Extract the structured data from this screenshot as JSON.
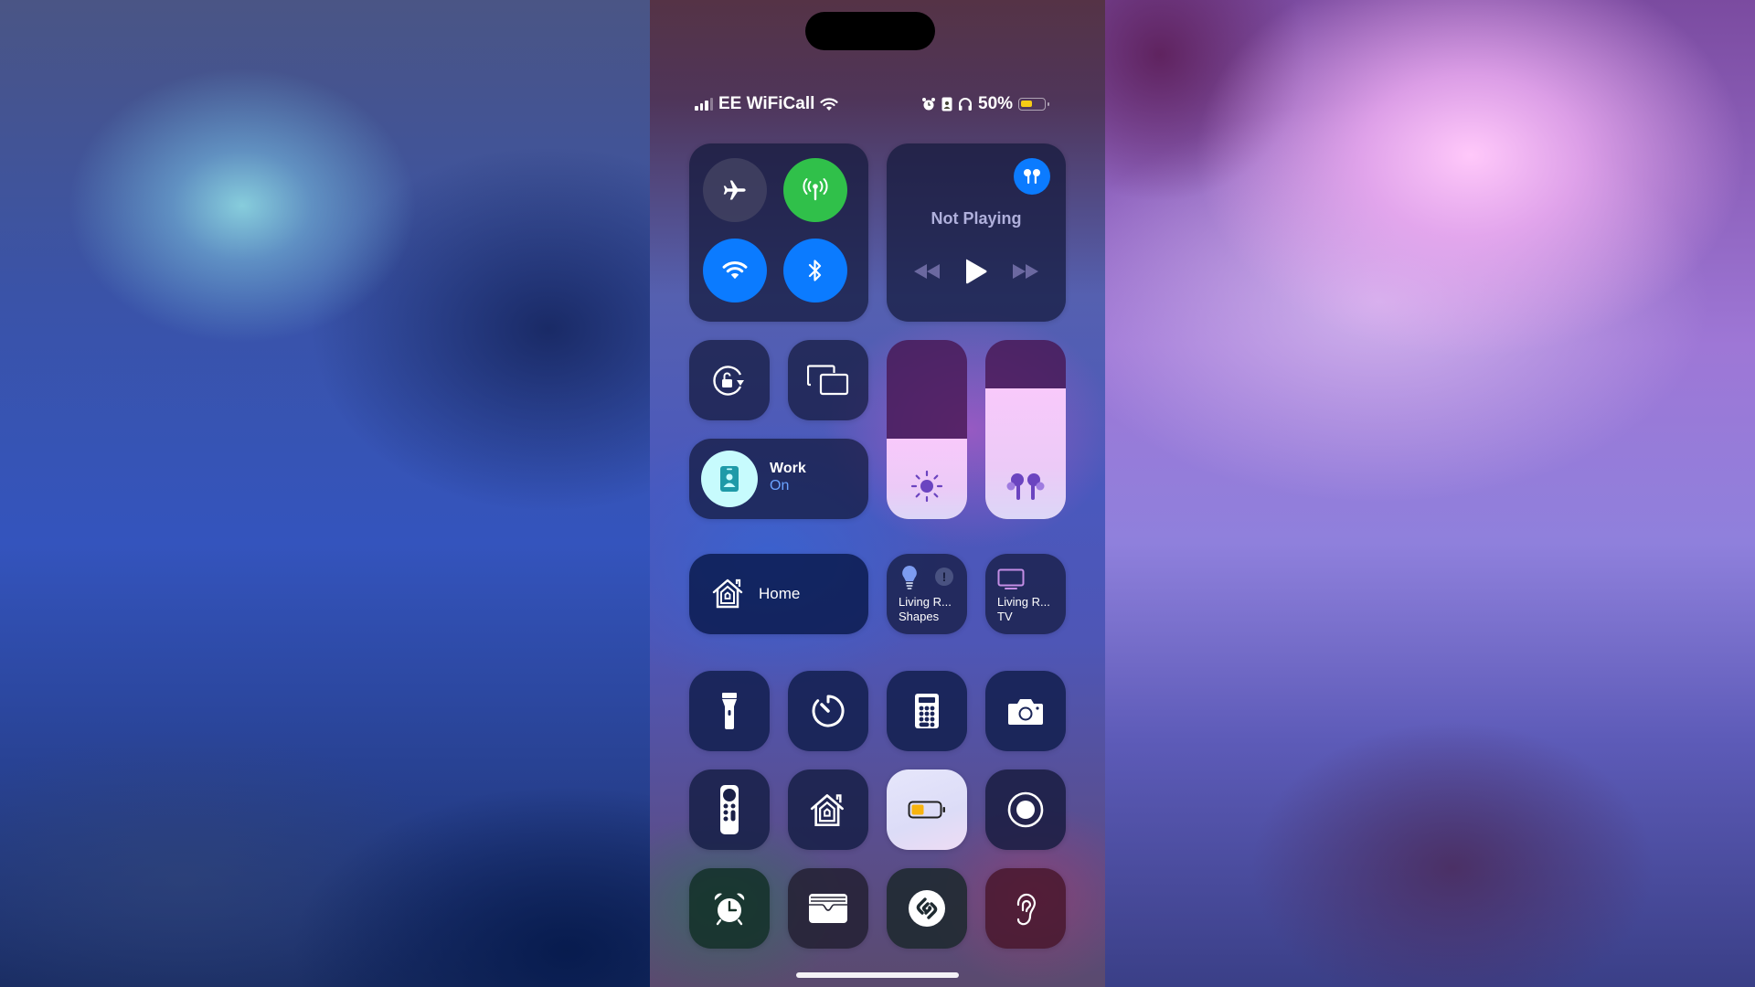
{
  "status_bar": {
    "carrier": "EE WiFiCall",
    "battery_percent_label": "50%",
    "battery_level": 0.5,
    "signal_bars": 3,
    "signal_bars_total": 4,
    "icons": [
      "cellular-signal-icon",
      "wifi-icon",
      "alarm-icon",
      "work-focus-icon",
      "headphones-icon",
      "battery-icon"
    ]
  },
  "connectivity": {
    "airplane_mode": {
      "label": "Airplane Mode",
      "on": false
    },
    "cellular_data": {
      "label": "Cellular Data",
      "on": true,
      "color": "#30c04a"
    },
    "wifi": {
      "label": "Wi-Fi",
      "on": true,
      "color": "#0b7bff"
    },
    "bluetooth": {
      "label": "Bluetooth",
      "on": true,
      "color": "#0b7bff"
    }
  },
  "media": {
    "title": "Not Playing",
    "output_device": "airpods-icon",
    "controls": [
      "rewind-icon",
      "play-icon",
      "fast-forward-icon"
    ]
  },
  "toggles": {
    "orientation_lock": "orientation-lock-icon",
    "screen_mirroring": "screen-mirroring-icon"
  },
  "focus": {
    "name": "Work",
    "state": "On"
  },
  "sliders": {
    "brightness": {
      "label": "Brightness",
      "level_percent": 45
    },
    "volume": {
      "label": "Volume",
      "level_percent": 73
    }
  },
  "home": {
    "label": "Home",
    "accessories": [
      {
        "line1": "Living R...",
        "line2": "Shapes",
        "icon": "lightbulb-icon",
        "alert": true
      },
      {
        "line1": "Living R...",
        "line2": "TV",
        "icon": "tv-icon",
        "alert": false
      }
    ]
  },
  "app_tiles": [
    {
      "name": "flashlight",
      "icon": "flashlight-icon"
    },
    {
      "name": "timer",
      "icon": "timer-icon"
    },
    {
      "name": "calculator",
      "icon": "calculator-icon"
    },
    {
      "name": "camera",
      "icon": "camera-icon"
    },
    {
      "name": "apple-tv-remote",
      "icon": "remote-icon"
    },
    {
      "name": "home-app",
      "icon": "home-icon"
    },
    {
      "name": "low-power-mode",
      "icon": "battery-icon",
      "on": true
    },
    {
      "name": "screen-recording",
      "icon": "screen-record-icon"
    },
    {
      "name": "alarm",
      "icon": "alarm-icon"
    },
    {
      "name": "wallet",
      "icon": "wallet-icon"
    },
    {
      "name": "shazam",
      "icon": "shazam-icon"
    },
    {
      "name": "hearing",
      "icon": "ear-icon"
    }
  ]
}
